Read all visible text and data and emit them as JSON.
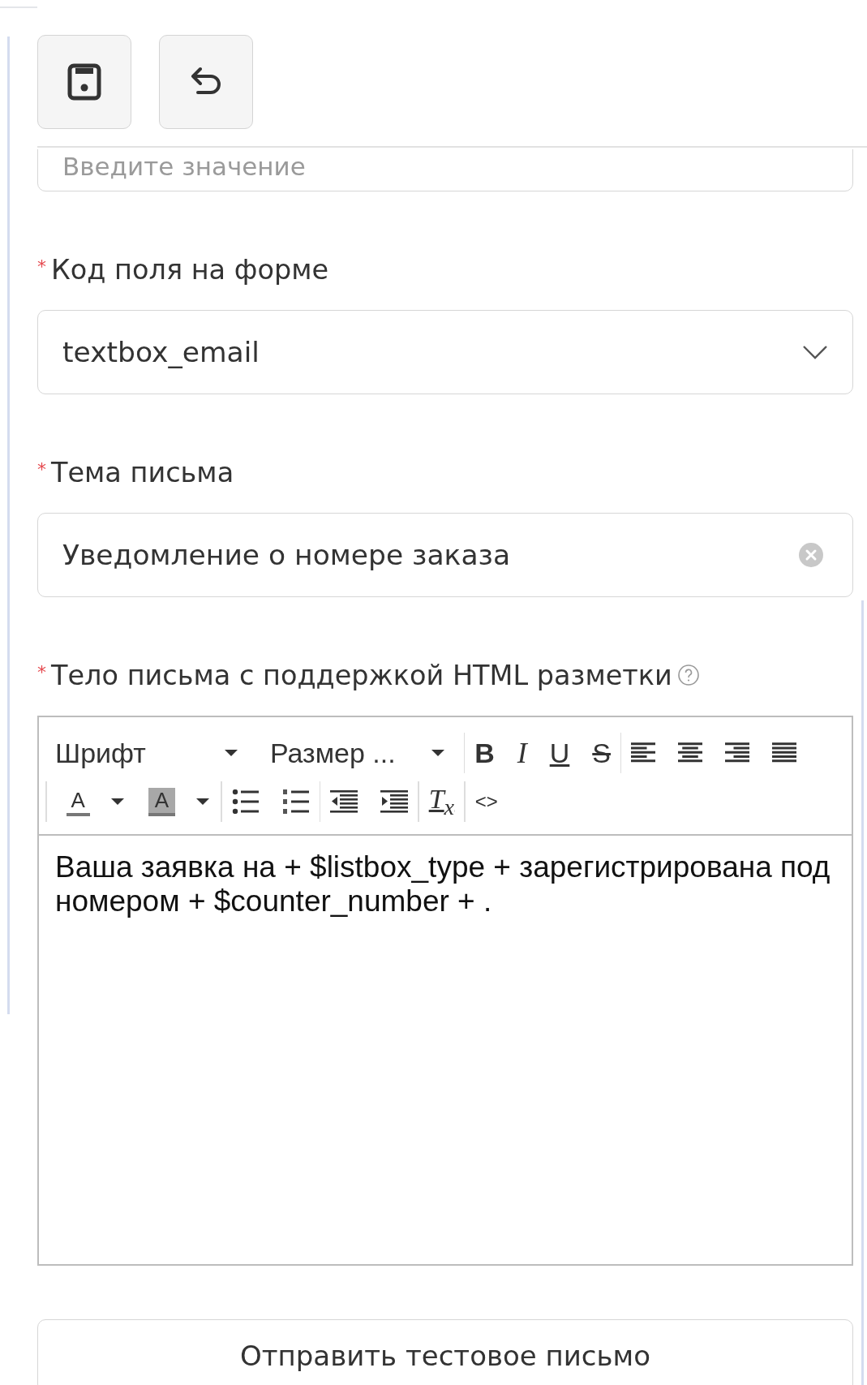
{
  "actions": [
    {
      "kind": "save"
    },
    {
      "kind": "undo"
    }
  ],
  "fields": [
    {
      "kind": "text",
      "placeholder": "Введите значение"
    },
    {
      "kind": "select",
      "label": "Код поля на форме",
      "required_mark": "*",
      "value": "textbox_email"
    },
    {
      "kind": "text",
      "label": "Тема письма",
      "required_mark": "*",
      "value": "Уведомление о номере заказа",
      "clearable": true
    },
    {
      "kind": "editor",
      "label": "Тело письма с поддержкой HTML разметки",
      "required_mark": "*",
      "help": true,
      "toolbar": [
        [
          [
            {
              "kind": "dropdown",
              "label": "Шрифт"
            },
            {
              "kind": "dropdown",
              "label": "Размер ..."
            }
          ],
          [
            {
              "kind": "bold",
              "label": "B"
            },
            {
              "kind": "italic",
              "label": "I"
            },
            {
              "kind": "underline",
              "label": "U"
            },
            {
              "kind": "strike",
              "label": "S"
            }
          ],
          [
            {
              "kind": "align-left"
            },
            {
              "kind": "align-center"
            },
            {
              "kind": "align-right"
            },
            {
              "kind": "align-justify"
            }
          ]
        ],
        [
          [
            {
              "kind": "text-color",
              "label": "A"
            },
            {
              "kind": "caret"
            },
            {
              "kind": "highlight",
              "label": "A"
            },
            {
              "kind": "caret"
            }
          ],
          [
            {
              "kind": "bullet-list"
            },
            {
              "kind": "numbered-list"
            }
          ],
          [
            {
              "kind": "outdent"
            },
            {
              "kind": "indent"
            }
          ],
          [
            {
              "kind": "clear-format",
              "label": "T$_{x}$"
            }
          ],
          [
            {
              "kind": "source",
              "label": "<>"
            }
          ]
        ]
      ],
      "content": "Ваша заявка на + $listbox_type + зарегистрирована под номером + $counter_number + ."
    }
  ],
  "send_button": "Отправить тестовое письмо"
}
